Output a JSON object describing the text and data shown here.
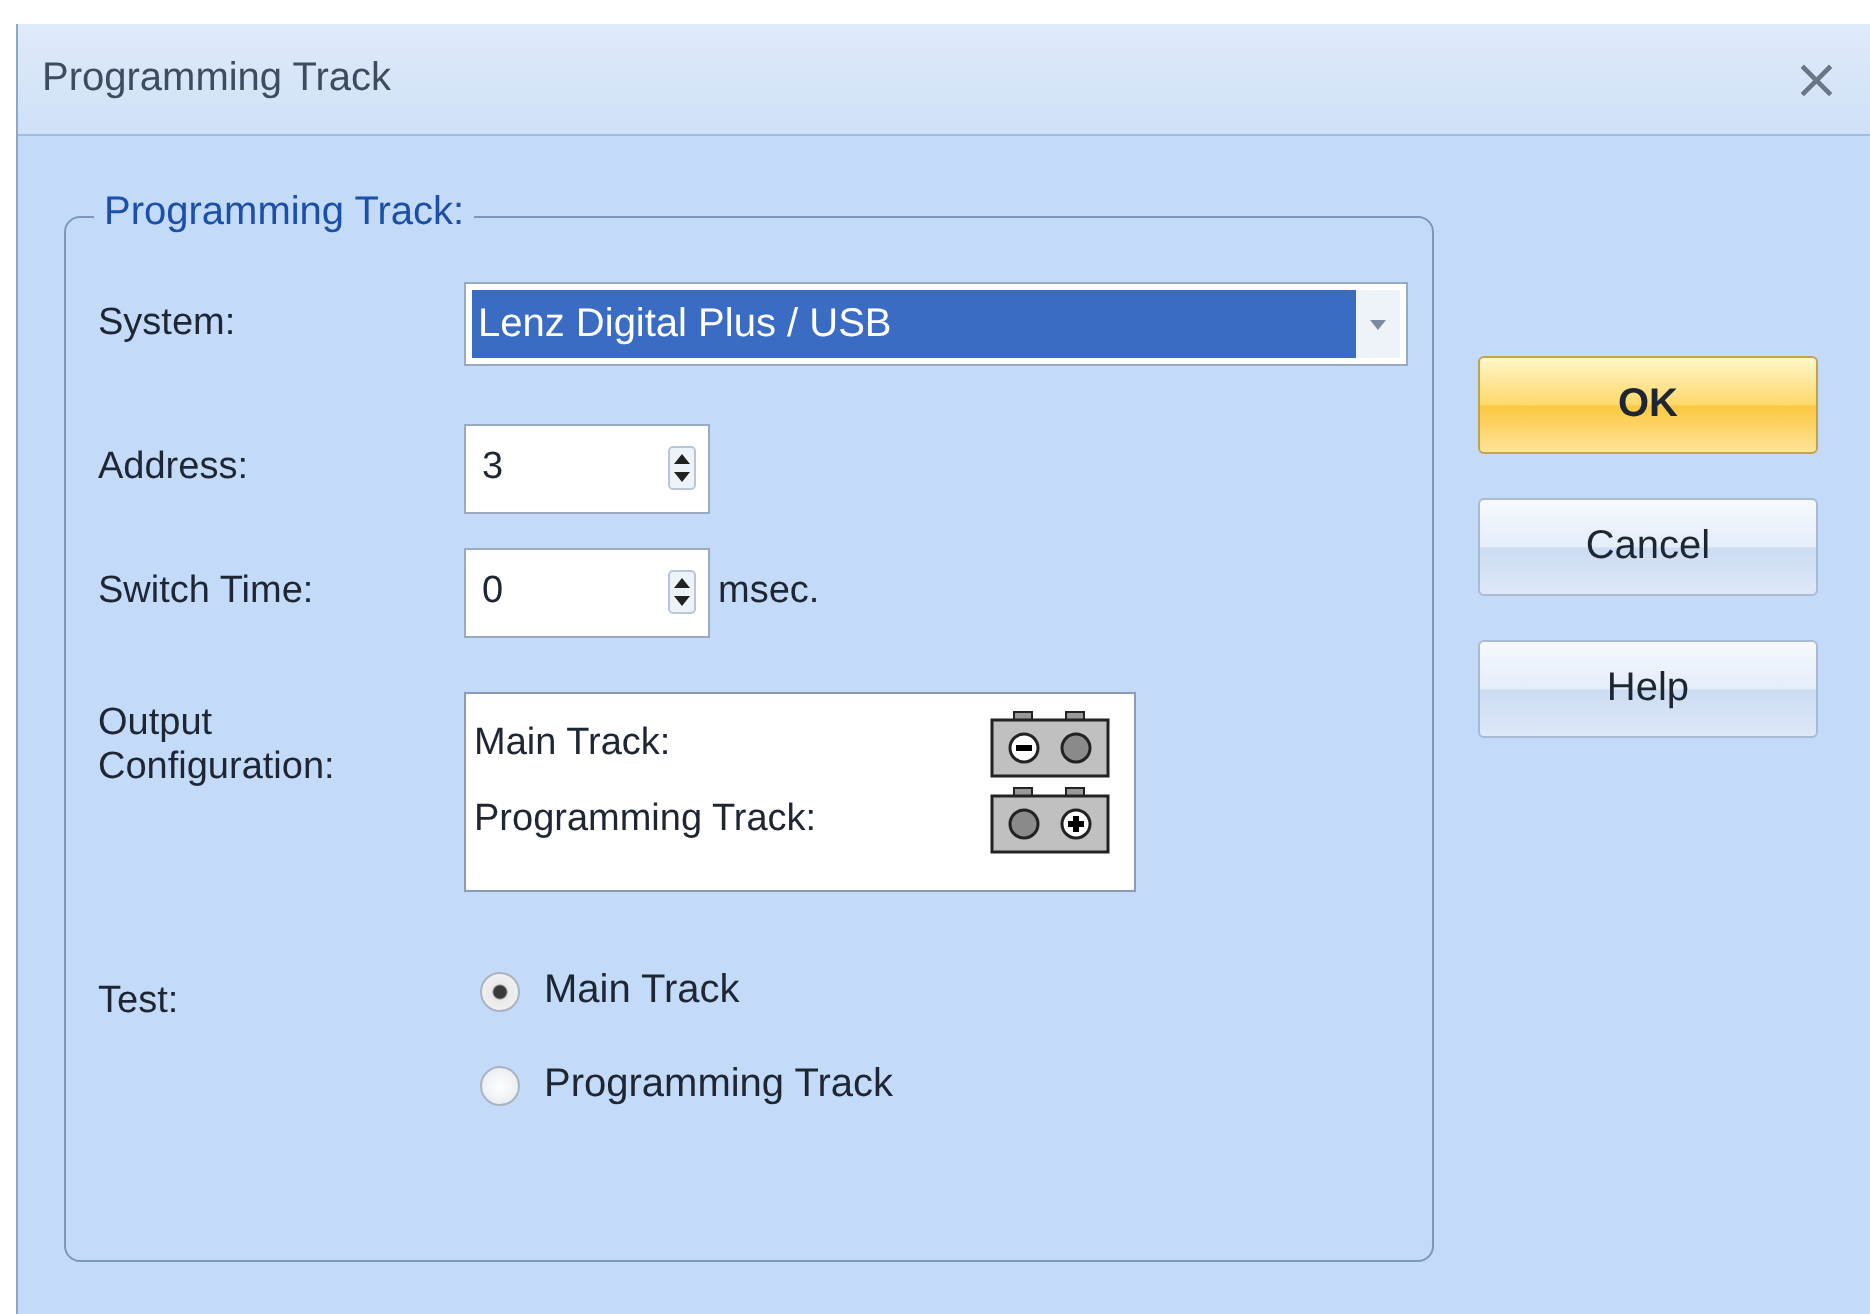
{
  "window": {
    "title": "Programming Track",
    "close": "×"
  },
  "group": {
    "title": "Programming Track:"
  },
  "system": {
    "label": "System:",
    "value": "Lenz Digital Plus / USB",
    "highlighted": true
  },
  "spinners": [
    {
      "label": "Address:",
      "value": "3"
    },
    {
      "label": "Switch Time:",
      "value": "0",
      "unit": "msec."
    }
  ],
  "output": {
    "label": "Output Configuration:",
    "rows": [
      {
        "label": "Main Track:",
        "kind": "negative"
      },
      {
        "label": "Programming Track:",
        "kind": "positive"
      }
    ]
  },
  "test": {
    "label": "Test:",
    "options": [
      {
        "label": "Main Track",
        "selected": true
      },
      {
        "label": "Programming Track",
        "selected": false
      }
    ]
  },
  "buttons": [
    {
      "label": "OK",
      "default": true
    },
    {
      "label": "Cancel",
      "default": false
    },
    {
      "label": "Help",
      "default": false
    }
  ]
}
